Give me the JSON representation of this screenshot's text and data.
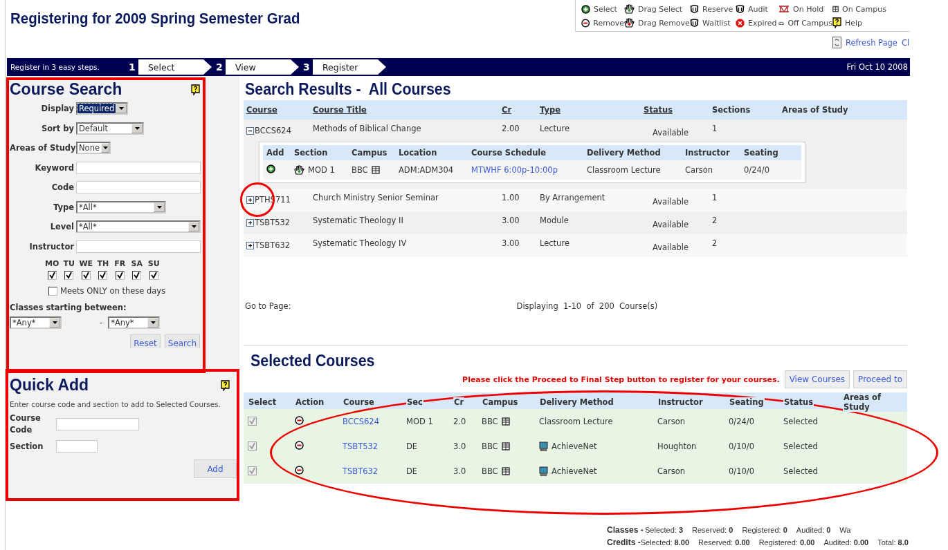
{
  "page_title": "Registering for 2009 Spring Semester Grad",
  "legend": [
    {
      "kind": "select",
      "label": "Select"
    },
    {
      "kind": "drag_select",
      "label": "Drag Select"
    },
    {
      "kind": "reserve",
      "label": "Reserve"
    },
    {
      "kind": "audit",
      "label": "Audit"
    },
    {
      "kind": "on_hold",
      "label": "On Hold"
    },
    {
      "kind": "on_campus",
      "label": "On Campus"
    },
    {
      "kind": "remove",
      "label": "Remove"
    },
    {
      "kind": "drag_remove",
      "label": "Drag Remove"
    },
    {
      "kind": "waitlist",
      "label": "Waitlist"
    },
    {
      "kind": "expired",
      "label": "Expired"
    },
    {
      "kind": "off_campus",
      "label": "Off Campus"
    },
    {
      "kind": "help",
      "label": "Help"
    }
  ],
  "links": [
    {
      "kind": "refresh",
      "label": "Refresh Page"
    },
    {
      "kind": "plain",
      "label": "Cl"
    }
  ],
  "steps_bar": {
    "intro": "Register in 3 easy steps.",
    "steps": [
      {
        "number": "1",
        "label": "Select"
      },
      {
        "number": "2",
        "label": "View"
      },
      {
        "number": "3",
        "label": "Register"
      }
    ],
    "date": "Fri Oct 10 2008"
  },
  "course_search": {
    "title": "Course Search",
    "fields": [
      {
        "kind": "select",
        "label": "Display",
        "value": "Required",
        "highlighted": true
      },
      {
        "kind": "select",
        "label": "Sort by",
        "value": "Default",
        "highlighted": false
      },
      {
        "kind": "select",
        "label": "Areas of Study",
        "value": "None",
        "highlighted": false
      },
      {
        "kind": "text",
        "label": "Keyword",
        "highlighted": false
      },
      {
        "kind": "text",
        "label": "Code",
        "highlighted": false
      },
      {
        "kind": "select",
        "label": "Type",
        "value": "*All*",
        "highlighted": false
      },
      {
        "kind": "select",
        "label": "Level",
        "value": "*All*",
        "highlighted": false
      },
      {
        "kind": "text",
        "label": "Instructor",
        "highlighted": false
      }
    ],
    "days": [
      {
        "label": "MO",
        "checked": true
      },
      {
        "label": "TU",
        "checked": true
      },
      {
        "label": "WE",
        "checked": true
      },
      {
        "label": "TH",
        "checked": true
      },
      {
        "label": "FR",
        "checked": true
      },
      {
        "label": "SA",
        "checked": true
      },
      {
        "label": "SU",
        "checked": true
      }
    ],
    "only_these_days": {
      "label": "Meets ONLY on these days",
      "checked": false
    },
    "start_label": "Classes starting between:",
    "start_from": "*Any*",
    "separator": "-",
    "start_to": "*Any*",
    "buttons": [
      "Reset",
      "Search"
    ]
  },
  "quick_add": {
    "title": "Quick Add",
    "hint": "Enter course code and section to add to Selected Courses.",
    "fields": [
      {
        "label": "Course Code"
      },
      {
        "label": "Section"
      }
    ],
    "button": "Add"
  },
  "search_results": {
    "title": "Search Results -  All Courses",
    "columns": [
      {
        "label": "Course",
        "sortable": true
      },
      {
        "label": "Course Title",
        "sortable": true
      },
      {
        "label": "Cr",
        "sortable": true
      },
      {
        "label": "Type",
        "sortable": true
      },
      {
        "label": "Status",
        "sortable": true
      },
      {
        "label": "Sections",
        "sortable": false
      },
      {
        "label": "Areas of Study",
        "sortable": false
      }
    ],
    "rows": [
      {
        "course": "BCCS624",
        "title": "Methods of Biblical Change",
        "cr": "2.00",
        "type": "Lecture",
        "status": "Available",
        "sections": "1",
        "expanded": true,
        "section_table": {
          "columns": [
            "Add",
            "Section",
            "Campus",
            "Location",
            "Course Schedule",
            "Delivery Method",
            "Instructor",
            "Seating"
          ],
          "rows": [
            {
              "section": "MOD 1",
              "campus": "BBC",
              "location": "ADM:ADM304",
              "schedule": "MTWHF 6:00p-10:00p",
              "delivery": "Classroom Lecture",
              "instructor": "Carson",
              "seating": "0/24/0"
            }
          ]
        }
      },
      {
        "course": "PTHS711",
        "title": "Church Ministry Senior Seminar",
        "cr": "1.00",
        "type": "By Arrangement",
        "status": "Available",
        "sections": "1",
        "expanded": false
      },
      {
        "course": "TSBT532",
        "title": "Systematic Theology II",
        "cr": "3.00",
        "type": "Module",
        "status": "Available",
        "sections": "2",
        "expanded": false
      },
      {
        "course": "TSBT632",
        "title": "Systematic Theology IV",
        "cr": "3.00",
        "type": "Lecture",
        "status": "Available",
        "sections": "2",
        "expanded": false
      }
    ],
    "pager_label": "Go to Page:",
    "display": "Displaying  1-10  of  200  Course(s)"
  },
  "selected_courses": {
    "title": "Selected Courses",
    "notice": "Please click the Proceed to Final Step button to register for your courses.",
    "buttons": [
      "View Courses",
      "Proceed to"
    ],
    "columns": [
      "Select",
      "Action",
      "Course",
      "Sec",
      "Cr",
      "Campus",
      "Delivery Method",
      "Instructor",
      "Seating",
      "Status",
      "Areas of Study"
    ],
    "rows": [
      {
        "checked": true,
        "course": "BCCS624",
        "sec": "MOD 1",
        "cr": "2.0",
        "campus": "BBC",
        "online": false,
        "delivery": "Classroom Lecture",
        "instructor": "Carson",
        "seating": "0/24/0",
        "status": "Selected"
      },
      {
        "checked": true,
        "course": "TSBT532",
        "sec": "DE",
        "cr": "3.0",
        "campus": "BBC",
        "online": true,
        "delivery": "AchieveNet",
        "instructor": "Houghton",
        "seating": "0/10/0",
        "status": "Selected"
      },
      {
        "checked": true,
        "course": "TSBT632",
        "sec": "DE",
        "cr": "3.0",
        "campus": "BBC",
        "online": true,
        "delivery": "AchieveNet",
        "instructor": "Carson",
        "seating": "0/10/0",
        "status": "Selected"
      }
    ]
  },
  "summary": [
    {
      "label": "Classes -",
      "items": [
        "Selected: **3**",
        "Reserved: **0**",
        "Registered: **0**",
        "Audited: **0**",
        "Wa"
      ]
    },
    {
      "label": "Credits -",
      "items": [
        "Selected: **8.00**",
        "Reserved: **0.00**",
        "Registered: **0.00**",
        "Audited: **0.00**",
        "Total: **8.0**"
      ]
    }
  ],
  "annotations": [
    {
      "kind": "frame"
    },
    {
      "kind": "frame"
    },
    {
      "kind": "circle"
    },
    {
      "kind": "ellipse"
    }
  ]
}
